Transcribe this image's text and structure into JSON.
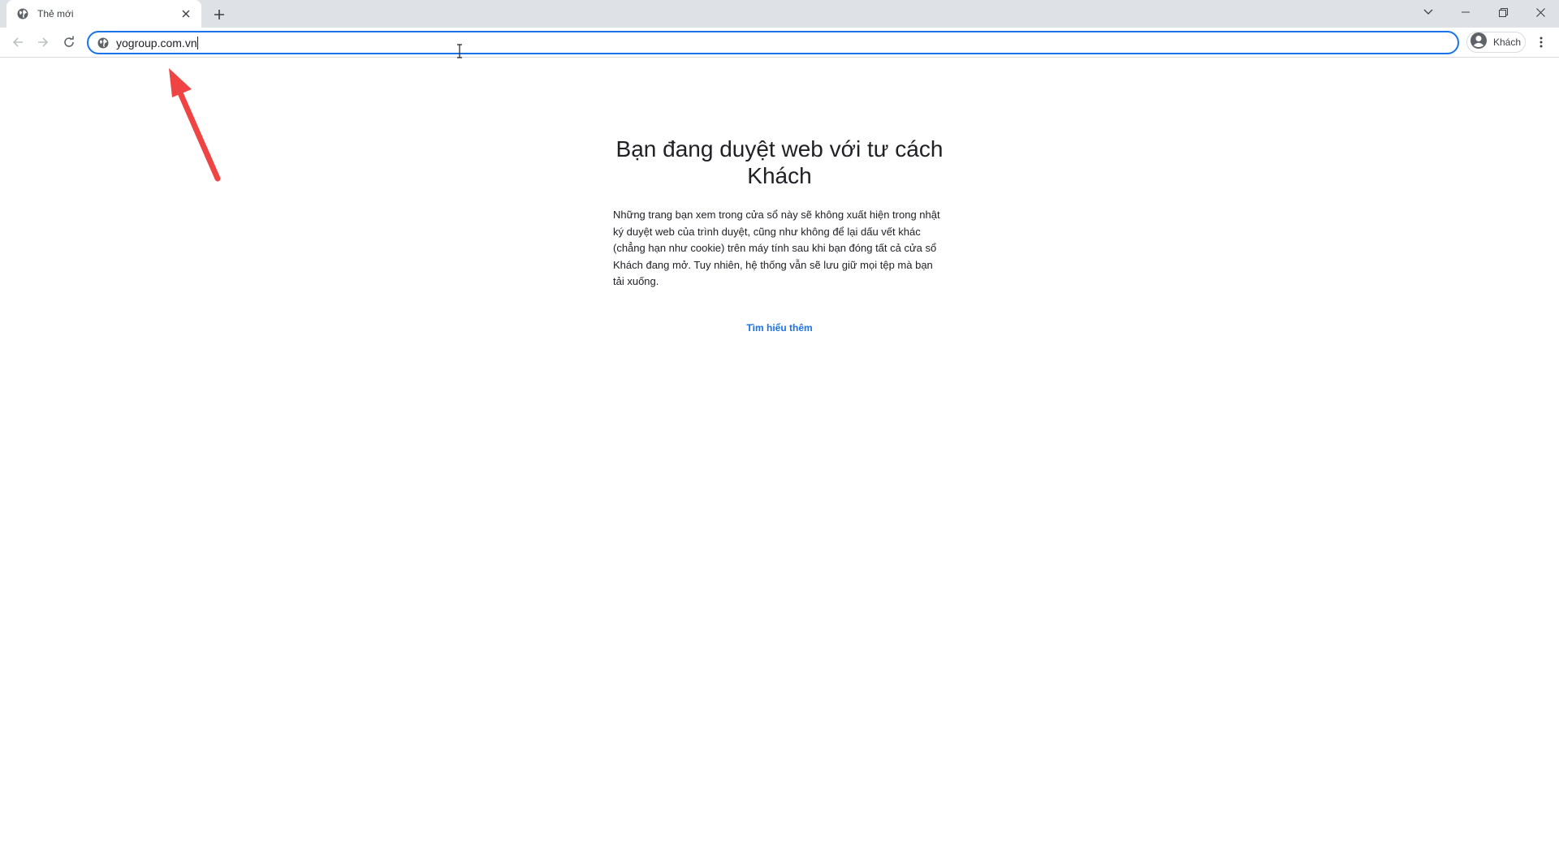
{
  "browser": {
    "tab": {
      "title": "Thẻ mới",
      "favicon": "globe-icon"
    },
    "window_controls": [
      "chevron-down-icon",
      "minimize-icon",
      "restore-icon",
      "close-icon"
    ],
    "omnibox": {
      "value": "yogroup.com.vn",
      "icon": "globe-icon",
      "focus_color": "#1a73e8"
    },
    "profile": {
      "label": "Khách",
      "icon": "avatar-icon"
    }
  },
  "page": {
    "title": "Bạn đang duyệt web với tư cách Khách",
    "description": "Những trang bạn xem trong cửa sổ này sẽ không xuất hiện trong nhật ký duyệt web của trình duyệt, cũng như không để lại dấu vết khác (chẳng hạn như cookie) trên máy tính sau khi bạn đóng tất cả cửa sổ Khách đang mở. Tuy nhiên, hệ thống vẫn sẽ lưu giữ mọi tệp mà bạn tải xuống.",
    "learn_more": "Tìm hiểu thêm",
    "link_color": "#1a73e8"
  },
  "annotation": {
    "type": "arrow",
    "color": "#f04444"
  }
}
